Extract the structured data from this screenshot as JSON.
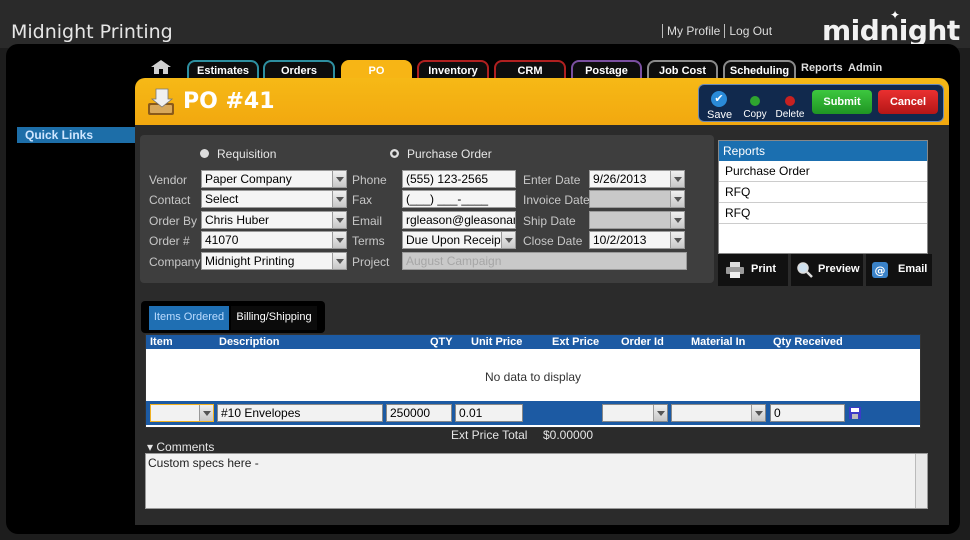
{
  "app_title": "Midnight Printing",
  "top_links": {
    "profile": "My Profile",
    "logout": "Log Out"
  },
  "logo": "midnight",
  "sidebar": {
    "quick_links": "Quick Links"
  },
  "tabs": [
    "Estimates",
    "Orders",
    "PO",
    "Inventory",
    "CRM",
    "Postage",
    "Job Cost",
    "Scheduling"
  ],
  "tabs_plain": [
    "Reports",
    "Admin"
  ],
  "header": {
    "title": "PO #41"
  },
  "actions": {
    "save": "Save",
    "copy": "Copy",
    "delete": "Delete",
    "submit": "Submit",
    "cancel": "Cancel"
  },
  "form": {
    "radio_requisition": "Requisition",
    "radio_po": "Purchase Order",
    "selected_type": "Purchase Order",
    "labels": {
      "vendor": "Vendor",
      "contact": "Contact",
      "order_by": "Order By",
      "order_no": "Order #",
      "company": "Company",
      "phone": "Phone",
      "fax": "Fax",
      "email": "Email",
      "terms": "Terms",
      "project": "Project",
      "enter_date": "Enter Date",
      "invoice_date": "Invoice Date",
      "ship_date": "Ship Date",
      "close_date": "Close Date"
    },
    "values": {
      "vendor": "Paper Company",
      "contact": "Select",
      "order_by": "Chris Huber",
      "order_no": "41070",
      "company": "Midnight Printing",
      "phone": "(555) 123-2565",
      "fax": "(___) ___-____",
      "email": "rgleason@gleasonandc",
      "terms": "Due Upon Receipt",
      "project_placeholder": "August Campaign",
      "enter_date": "9/26/2013",
      "invoice_date": "",
      "ship_date": "",
      "close_date": "10/2/2013"
    }
  },
  "reports_panel": {
    "header": "Reports",
    "items": [
      "Purchase Order",
      "RFQ",
      "RFQ"
    ],
    "buttons": {
      "print": "Print",
      "preview": "Preview",
      "email": "Email"
    }
  },
  "subtabs": [
    "Items Ordered",
    "Billing/Shipping"
  ],
  "grid": {
    "columns": [
      "Item",
      "Description",
      "QTY",
      "Unit Price",
      "Ext Price",
      "Order Id",
      "Material In",
      "Qty Received"
    ],
    "empty_text": "No data to display",
    "edit_row": {
      "item": "",
      "description": "#10 Envelopes",
      "qty": "250000",
      "unit_price": "0.01",
      "qty_received": "0"
    }
  },
  "totals": {
    "label": "Ext Price Total",
    "value": "$0.00000"
  },
  "comments": {
    "label": "Comments",
    "text": "Custom specs here -"
  },
  "colors": {
    "accent": "#f7b515",
    "blue": "#1c5aa3",
    "submit": "#22a52a",
    "cancel": "#cf1a1a"
  }
}
